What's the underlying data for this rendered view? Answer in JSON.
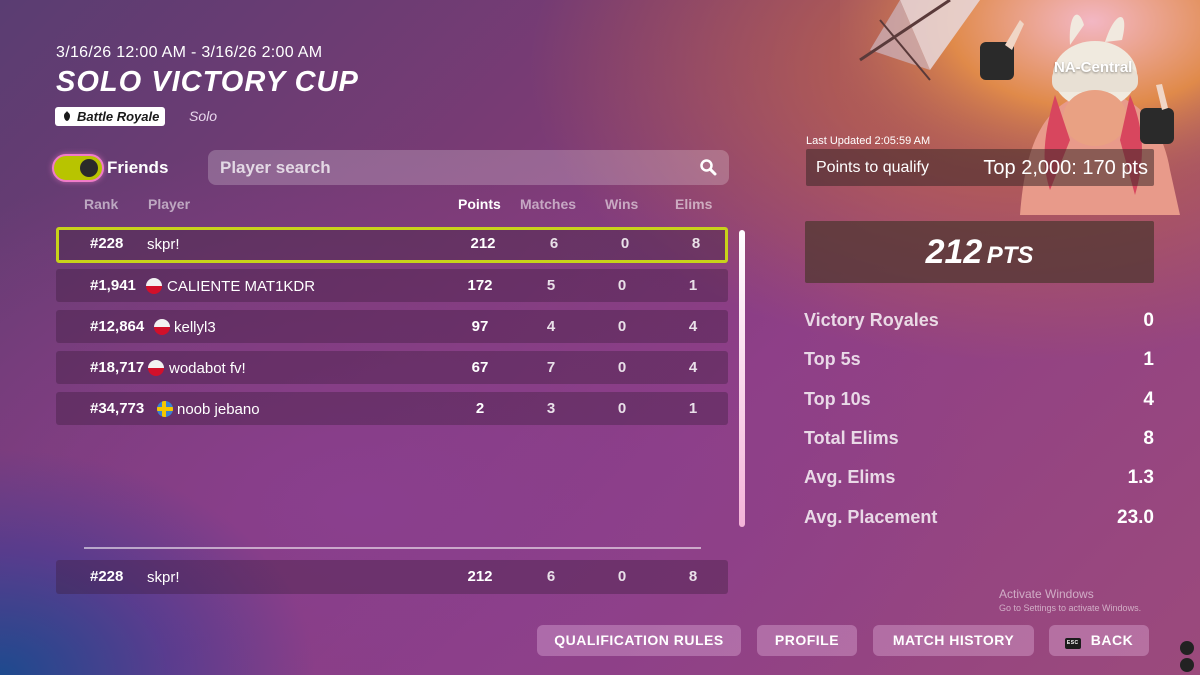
{
  "header": {
    "date_range": "3/16/26 12:00 AM - 3/16/26 2:00 AM",
    "title": "SOLO VICTORY CUP",
    "mode": "Battle Royale",
    "mode_sub": "Solo"
  },
  "filters": {
    "friends_label": "Friends",
    "friends_enabled": true,
    "search_placeholder": "Player search",
    "search_value": ""
  },
  "table": {
    "headers": {
      "rank": "Rank",
      "player": "Player",
      "points": "Points",
      "matches": "Matches",
      "wins": "Wins",
      "elims": "Elims"
    },
    "rows": [
      {
        "rank": "#228",
        "player": "skpr!",
        "flag": "",
        "points": "212",
        "matches": "6",
        "wins": "0",
        "elims": "8",
        "highlight": true
      },
      {
        "rank": "#1,941",
        "player": "CALIENTE MAT1KDR",
        "flag": "pl",
        "points": "172",
        "matches": "5",
        "wins": "0",
        "elims": "1"
      },
      {
        "rank": "#12,864",
        "player": "kellyl3",
        "flag": "pl",
        "points": "97",
        "matches": "4",
        "wins": "0",
        "elims": "4"
      },
      {
        "rank": "#18,717",
        "player": "wodabot fv!",
        "flag": "pl",
        "points": "67",
        "matches": "7",
        "wins": "0",
        "elims": "4"
      },
      {
        "rank": "#34,773",
        "player": "noob jebano",
        "flag": "se",
        "points": "2",
        "matches": "3",
        "wins": "0",
        "elims": "1"
      }
    ],
    "self_row": {
      "rank": "#228",
      "player": "skpr!",
      "points": "212",
      "matches": "6",
      "wins": "0",
      "elims": "8"
    }
  },
  "summary": {
    "region": "NA-Central",
    "last_updated": "Last Updated 2:05:59 AM",
    "qualify_label": "Points to qualify",
    "qualify_value": "Top 2,000: 170 pts",
    "points_value": "212",
    "points_unit": "PTS",
    "stats": [
      {
        "label": "Victory Royales",
        "value": "0"
      },
      {
        "label": "Top 5s",
        "value": "1"
      },
      {
        "label": "Top 10s",
        "value": "4"
      },
      {
        "label": "Total Elims",
        "value": "8"
      },
      {
        "label": "Avg. Elims",
        "value": "1.3"
      },
      {
        "label": "Avg. Placement",
        "value": "23.0"
      }
    ]
  },
  "watermark": {
    "title": "Activate Windows",
    "sub": "Go to Settings to activate Windows."
  },
  "buttons": {
    "qualification_rules": "QUALIFICATION RULES",
    "profile": "PROFILE",
    "match_history": "MATCH HISTORY",
    "esc_key": "ESC",
    "back": "BACK"
  },
  "colors": {
    "highlight_border": "#c8d21a",
    "toggle_on": "#b8c400",
    "toggle_ring": "#f07cc9"
  }
}
